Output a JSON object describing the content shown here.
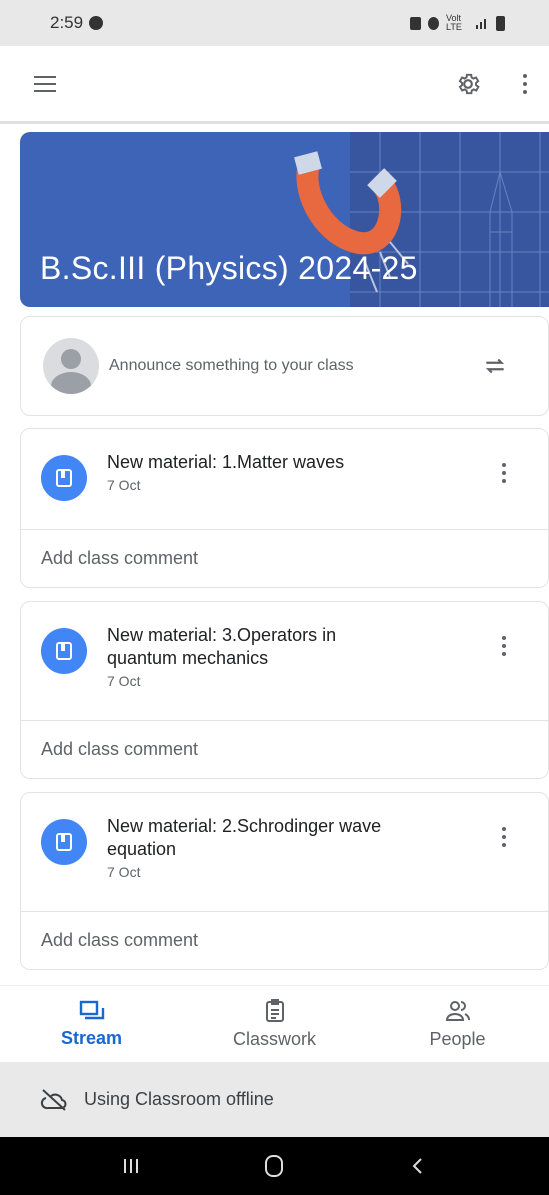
{
  "status_bar": {
    "time": "2:59",
    "network": "Volt LTE"
  },
  "app_bar": {
    "menu_icon": "menu-icon",
    "settings_icon": "gear-icon",
    "more_icon": "more-vert-icon"
  },
  "banner": {
    "title": "B.Sc.III (Physics) 2024-25",
    "color": "#3e64b7"
  },
  "announce": {
    "placeholder": "Announce something to your class",
    "repost_icon": "repost-icon"
  },
  "posts": [
    {
      "title_line1": "New material: 1.Matter waves",
      "title_line2": "",
      "date": "7 Oct",
      "comment": "Add class comment"
    },
    {
      "title_line1": "New material: 3.Operators in",
      "title_line2": "quantum mechanics",
      "date": "7 Oct",
      "comment": "Add class comment"
    },
    {
      "title_line1": "New material: 2.Schrodinger wave",
      "title_line2": "equation",
      "date": "7 Oct",
      "comment": "Add class comment"
    }
  ],
  "bottom_nav": [
    {
      "label": "Stream",
      "icon": "stream-icon",
      "active": true
    },
    {
      "label": "Classwork",
      "icon": "classwork-icon",
      "active": false
    },
    {
      "label": "People",
      "icon": "people-icon",
      "active": false
    }
  ],
  "offline_bar": {
    "text": "Using Classroom offline",
    "icon": "cloud-off-icon"
  },
  "accent_color": "#1967d2"
}
